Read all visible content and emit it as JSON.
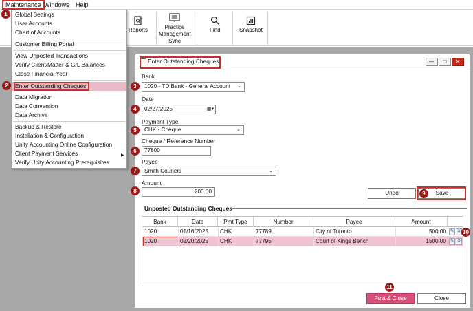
{
  "menubar": {
    "maintenance": "Maintenance",
    "windows": "Windows",
    "help": "Help"
  },
  "toolbar": {
    "reports": "Reports",
    "practice_line1": "Practice",
    "practice_line2": "Management",
    "practice_line3": "Sync",
    "find": "Find",
    "snapshot": "Snapshot"
  },
  "maintenance_menu": {
    "items": [
      "Global Settings",
      "User Accounts",
      "Chart of Accounts",
      "Customer Billing Portal",
      "View Unposted Transactions",
      "Verify Client/Matter & G/L Balances",
      "Close Financial Year",
      "Enter Outstanding Cheques",
      "Data Migration",
      "Data Conversion",
      "Data Archive",
      "Backup & Restore",
      "Installation & Configuration",
      "Unity Accounting Online Configuration",
      "Client Payment Services",
      "Verify Unity Accounting Prerequisites"
    ]
  },
  "markers": [
    "1",
    "2",
    "3",
    "4",
    "5",
    "6",
    "7",
    "8",
    "9",
    "10",
    "11"
  ],
  "dialog": {
    "title": "Enter Outstanding Cheques",
    "bank_label": "Bank",
    "bank_value": "1020 - TD Bank - General Account",
    "date_label": "Date",
    "date_value": "02/27/2025",
    "payment_type_label": "Payment Type",
    "payment_type_value": "CHK - Cheque",
    "cheque_label": "Cheque / Reference Number",
    "cheque_value": "77800",
    "payee_label": "Payee",
    "payee_value": "Smith Couriers",
    "amount_label": "Amount",
    "amount_value": "200.00",
    "undo": "Undo",
    "save": "Save",
    "section_title": "Unposted Outstanding Cheques",
    "post_close": "Post & Close",
    "close": "Close"
  },
  "table": {
    "columns": [
      "Bank",
      "Date",
      "Pmt Type",
      "Number",
      "Payee",
      "Amount"
    ],
    "rows": [
      {
        "bank": "1020",
        "date": "01/16/2025",
        "pmt_type": "CHK",
        "number": "77789",
        "payee": "City of Toronto",
        "amount": "500.00"
      },
      {
        "bank": "1020",
        "date": "02/20/2025",
        "pmt_type": "CHK",
        "number": "77795",
        "payee": "Court of Kings Bench",
        "amount": "1500.00"
      }
    ]
  },
  "colors": {
    "accent": "#d6517a",
    "marker": "#9b1b1b",
    "highlight_box": "#c9302c"
  }
}
